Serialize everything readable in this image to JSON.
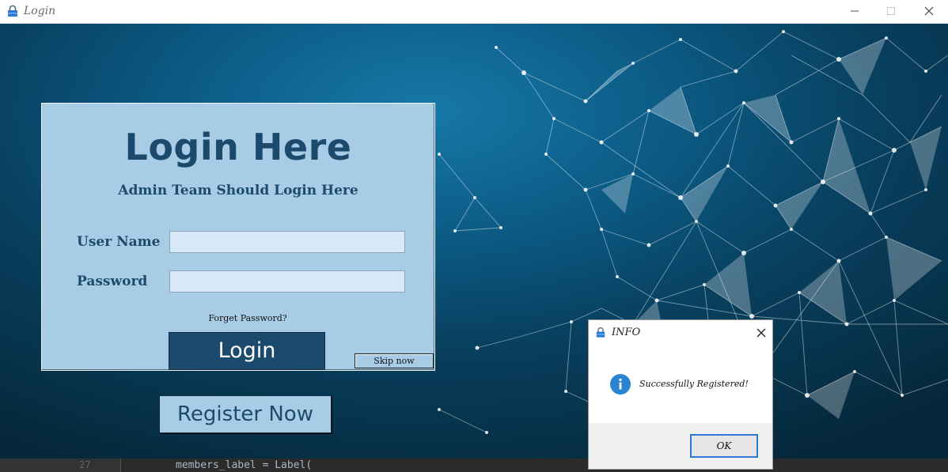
{
  "window": {
    "title": "Login",
    "icon": "lock-icon"
  },
  "login_panel": {
    "heading": "Login Here",
    "subheading": "Admin Team Should Login Here",
    "username_label": "User Name",
    "username_value": "",
    "password_label": "Password",
    "password_value": "",
    "forget_password": "Forget Password?",
    "login_button": "Login",
    "skip_button": "Skip now"
  },
  "register_button": "Register Now",
  "code_editor": {
    "line_number": "27",
    "code": "members_label = Label("
  },
  "dialog": {
    "title": "INFO",
    "message": "Successfully Registered!",
    "ok_button": "OK",
    "icon": "info-icon"
  },
  "colors": {
    "panel": "#a8cce6",
    "accent": "#1c4a6d",
    "field": "#d8e9f8",
    "focus": "#2a7ad5"
  }
}
